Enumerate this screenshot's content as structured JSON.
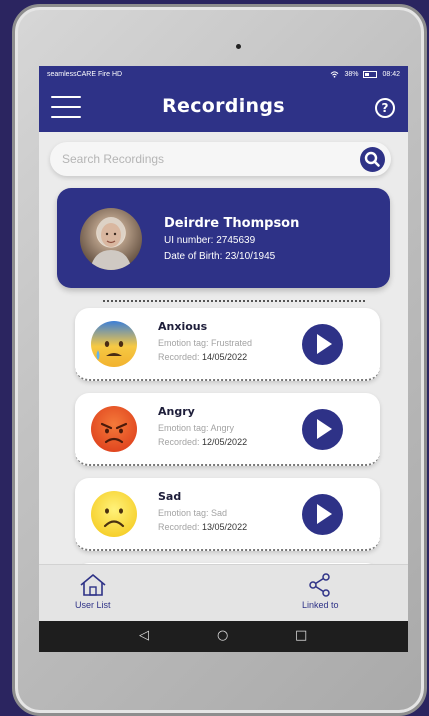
{
  "status_bar": {
    "carrier": "seamlessCARE Fire HD",
    "battery": "38%",
    "time": "08:42"
  },
  "header": {
    "title": "Recordings",
    "menu_icon": "hamburger-menu-icon",
    "help_icon": "help-circle-icon",
    "help_glyph": "?"
  },
  "search": {
    "placeholder": "Search Recordings",
    "icon": "search-icon"
  },
  "profile": {
    "name": "Deirdre Thompson",
    "ui_number": "UI number: 2745639",
    "dob": "Date of Birth: 23/10/1945"
  },
  "recordings": [
    {
      "title": "Anxious",
      "tag": "Emotion tag: Frustrated",
      "recorded_label": "Recorded: ",
      "date": "14/05/2022",
      "emoji": "anxious-face-icon"
    },
    {
      "title": "Angry",
      "tag": "Emotion tag: Angry",
      "recorded_label": "Recorded: ",
      "date": "12/05/2022",
      "emoji": "angry-face-icon"
    },
    {
      "title": "Sad",
      "tag": "Emotion tag: Sad",
      "recorded_label": "Recorded: ",
      "date": "13/05/2022",
      "emoji": "sad-face-icon"
    }
  ],
  "bottom_nav": {
    "user_list": "User List",
    "linked_to": "Linked to"
  },
  "system_nav": {
    "back": "◁",
    "home": "○",
    "recents": "□"
  },
  "colors": {
    "primary": "#2e3287",
    "background": "#ebebeb",
    "card": "#ffffff"
  }
}
